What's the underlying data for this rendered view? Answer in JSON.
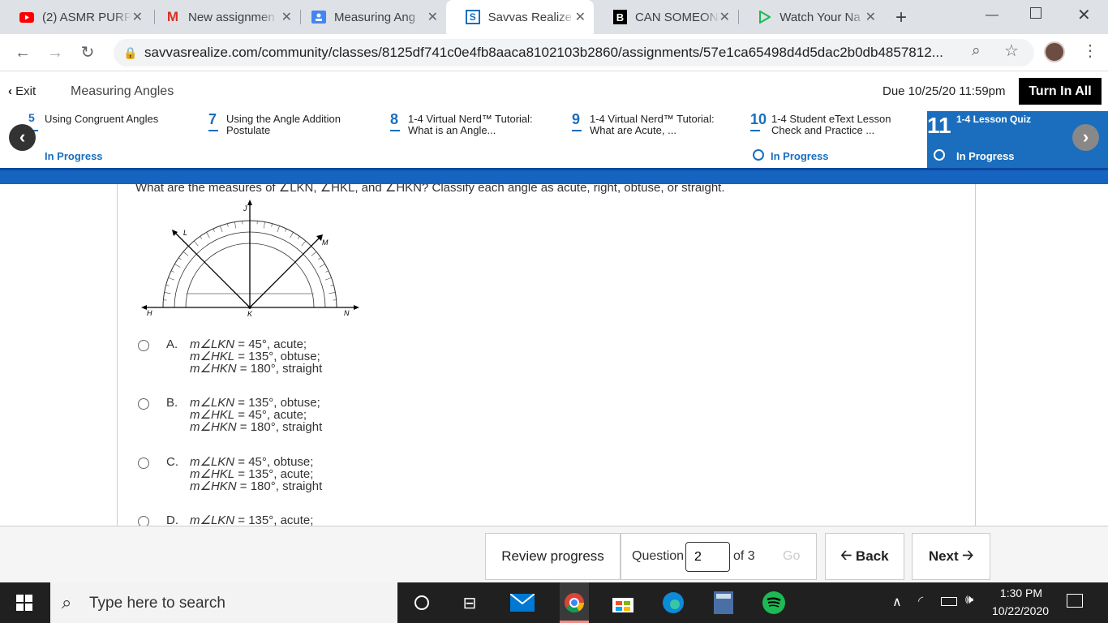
{
  "browser": {
    "tabs": [
      {
        "title": "(2) ASMR PURP",
        "icon": "youtube-icon",
        "color": "#ff0000"
      },
      {
        "title": "New assignmen",
        "icon": "gmail-icon",
        "color": "#d93025"
      },
      {
        "title": "Measuring Ang",
        "icon": "classroom-icon",
        "color": "#4285f4"
      },
      {
        "title": "Savvas Realize",
        "icon": "savvas-icon",
        "color": "#1a6ebd"
      },
      {
        "title": "CAN SOMEON",
        "icon": "brainly-icon",
        "color": "#000000"
      },
      {
        "title": "Watch Your Na",
        "icon": "play-icon",
        "color": "#1db954"
      }
    ],
    "url": "savvasrealize.com/community/classes/8125df741c0e4fb8aaca8102103b2860/assignments/57e1ca65498d4d5dac2b0db4857812..."
  },
  "header": {
    "exit_label": "Exit",
    "title": "Measuring Angles",
    "due": "Due 10/25/20 11:59pm",
    "turn_in": "Turn In All"
  },
  "lessons": [
    {
      "num": "5",
      "title": "Using Congruent Angles",
      "status": "In Progress"
    },
    {
      "num": "7",
      "title": "Using the Angle Addition Postulate",
      "status": ""
    },
    {
      "num": "8",
      "title": "1-4 Virtual Nerd™ Tutorial: What is an Angle...",
      "status": ""
    },
    {
      "num": "9",
      "title": "1-4 Virtual Nerd™ Tutorial: What are Acute, ...",
      "status": ""
    },
    {
      "num": "10",
      "title": "1-4 Student eText Lesson Check and Practice ...",
      "status": "In Progress"
    },
    {
      "num": "11",
      "title": "1-4 Lesson Quiz",
      "status": "In Progress"
    }
  ],
  "question": {
    "prompt": "What are the measures of ∠LKN, ∠HKL, and ∠HKN? Classify each angle as acute, right, obtuse, or straight.",
    "figure_labels": {
      "H": "H",
      "K": "K",
      "N": "N",
      "L": "L",
      "M": "M",
      "J": "J"
    },
    "choices": [
      {
        "letter": "A.",
        "lines": [
          [
            "m∠LKN",
            " = 45°, acute;"
          ],
          [
            "m∠HKL",
            " = 135°, obtuse;"
          ],
          [
            "m∠HKN",
            " = 180°, straight"
          ]
        ]
      },
      {
        "letter": "B.",
        "lines": [
          [
            "m∠LKN",
            " = 135°, obtuse;"
          ],
          [
            "m∠HKL",
            " = 45°, acute;"
          ],
          [
            "m∠HKN",
            " = 180°, straight"
          ]
        ]
      },
      {
        "letter": "C.",
        "lines": [
          [
            "m∠LKN",
            " = 45°, obtuse;"
          ],
          [
            "m∠HKL",
            " = 135°, acute;"
          ],
          [
            "m∠HKN",
            " = 180°, straight"
          ]
        ]
      },
      {
        "letter": "D.",
        "lines": [
          [
            "m∠LKN",
            " = 135°, acute;"
          ]
        ]
      }
    ]
  },
  "footer": {
    "review": "Review progress",
    "question_label": "Question",
    "question_value": "2",
    "of_label": "of 3",
    "go": "Go",
    "back": "Back",
    "next": "Next"
  },
  "taskbar": {
    "search_placeholder": "Type here to search",
    "time": "1:30 PM",
    "date": "10/22/2020"
  }
}
